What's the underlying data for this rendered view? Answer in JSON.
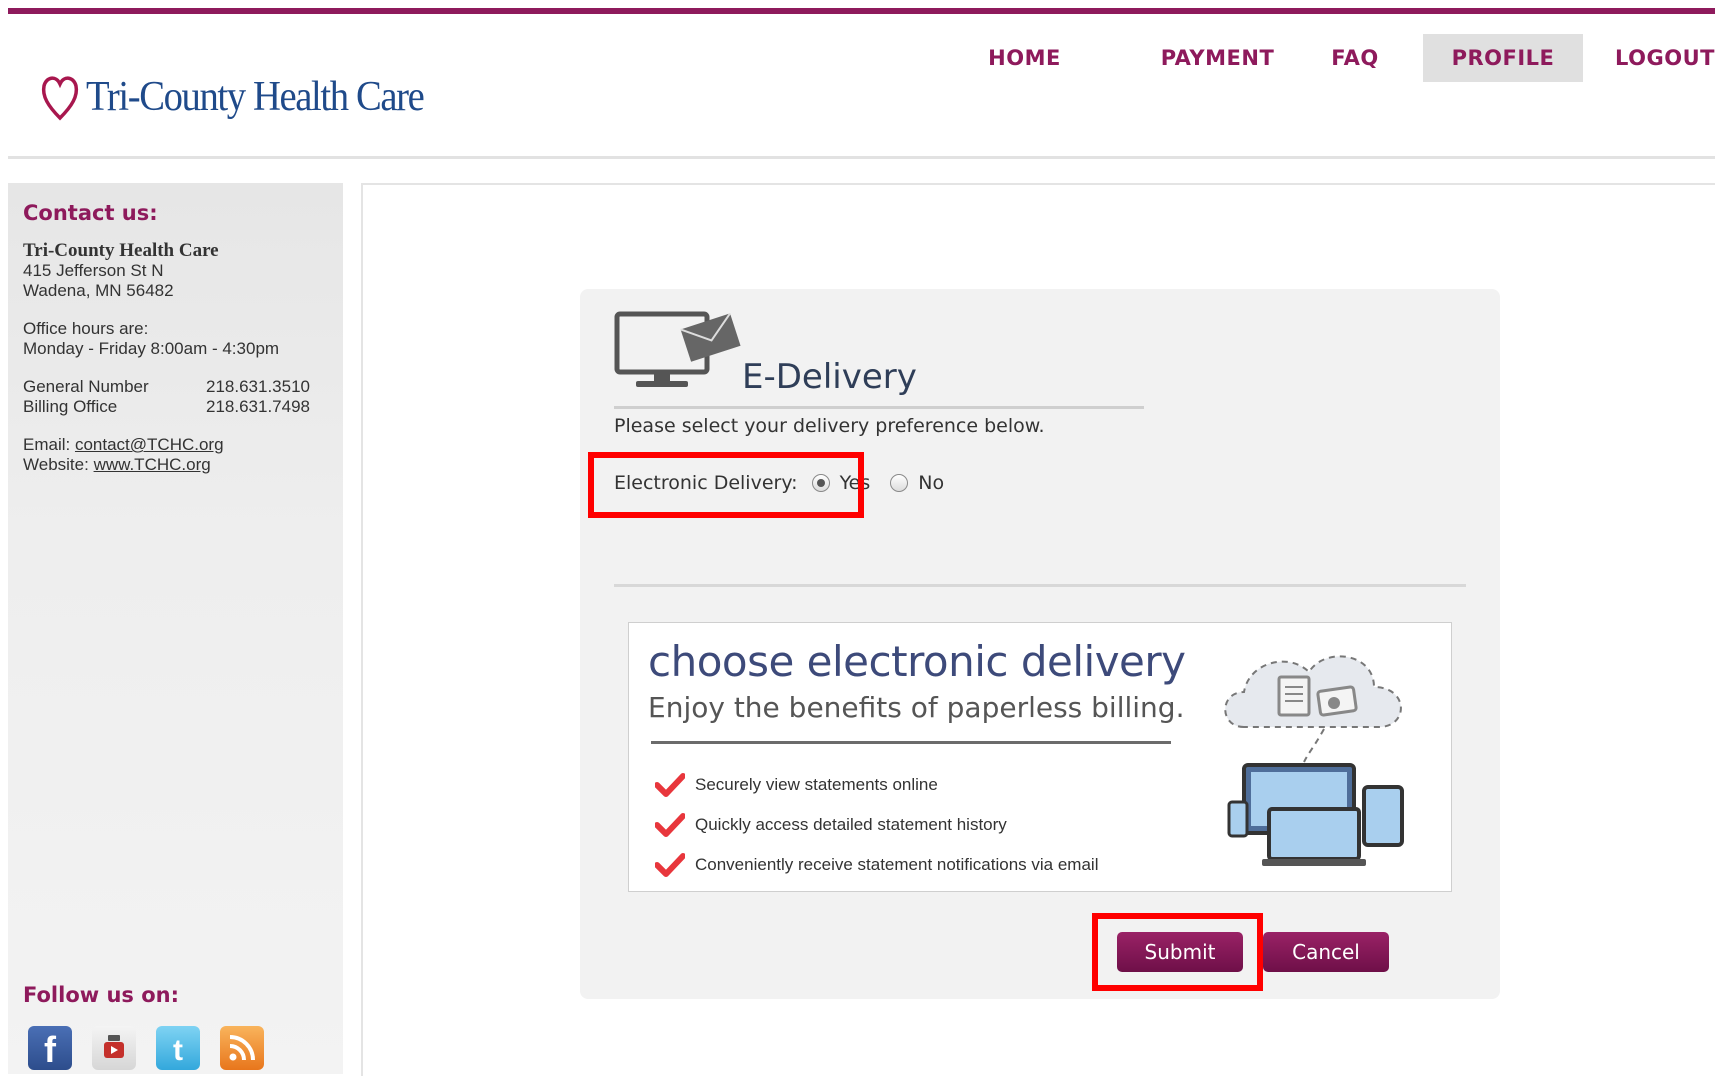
{
  "brand": {
    "name": "Tri-County Health Care",
    "accent": "#8e1a5c",
    "logo_color": "#1f4a8a"
  },
  "nav": {
    "items": [
      {
        "label": "HOME",
        "active": false
      },
      {
        "label": "PAYMENT",
        "active": false
      },
      {
        "label": "FAQ",
        "active": false
      },
      {
        "label": "PROFILE",
        "active": true
      },
      {
        "label": "LOGOUT",
        "active": false
      }
    ]
  },
  "sidebar": {
    "contact_heading": "Contact us:",
    "org_name": "Tri-County Health Care",
    "address_line1": "415 Jefferson St N",
    "address_line2": "Wadena, MN 56482",
    "hours_label": "Office hours are:",
    "hours_value": "Monday - Friday 8:00am - 4:30pm",
    "phones": [
      {
        "label": "General Number",
        "value": "218.631.3510"
      },
      {
        "label": "Billing Office",
        "value": "218.631.7498"
      }
    ],
    "email_label": "Email:",
    "email_value": "contact@TCHC.org",
    "website_label": "Website:",
    "website_value": "www.TCHC.org",
    "follow_heading": "Follow us on:",
    "social_icons": [
      "facebook-icon",
      "youtube-icon",
      "twitter-icon",
      "rss-icon"
    ]
  },
  "edelivery": {
    "title": "E-Delivery",
    "instruction": "Please select your delivery preference below.",
    "field_label": "Electronic Delivery:",
    "option_yes": "Yes",
    "option_no": "No",
    "selected": "Yes"
  },
  "promo": {
    "title": "choose electronic delivery",
    "subtitle": "Enjoy the benefits of paperless billing.",
    "benefits": [
      "Securely view statements online",
      "Quickly access detailed statement history",
      "Conveniently receive statement notifications via email"
    ]
  },
  "actions": {
    "submit_label": "Submit",
    "cancel_label": "Cancel"
  }
}
